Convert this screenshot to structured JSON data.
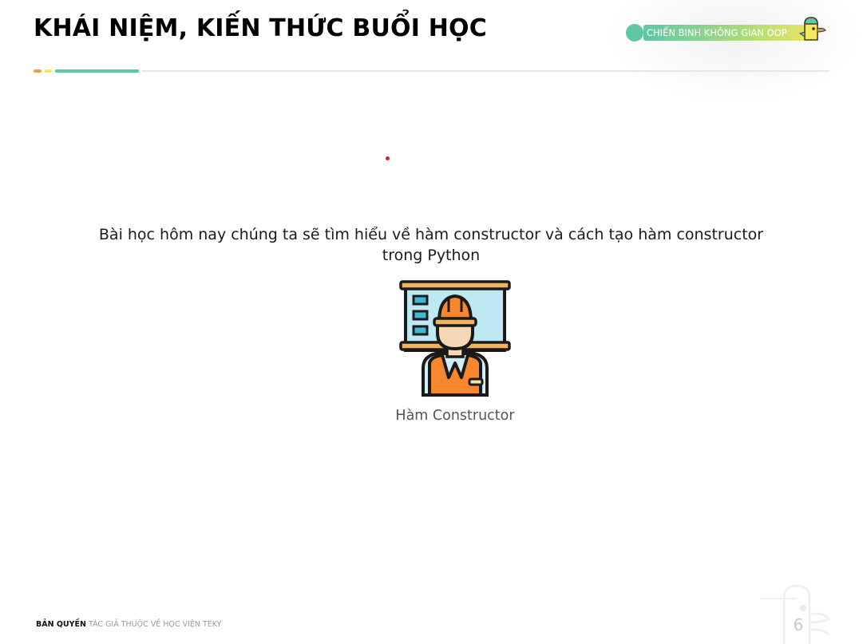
{
  "header": {
    "title": "KHÁI NIỆM, KIẾN THỨC BUỔI HỌC",
    "badge_label": "CHIẾN BINH KHÔNG GIAN OOP"
  },
  "main": {
    "intro_text": "Bài học hôm nay chúng ta sẽ tìm hiểu về hàm constructor và cách tạo hàm constructor trong Python",
    "illustration": "construction-worker-icon",
    "caption": "Hàm Constructor"
  },
  "footer": {
    "copyright_bold": "BẢN QUYỀN",
    "copyright_rest": "TÁC GIẢ THUỘC VỀ HỌC VIỆN TEKY",
    "page_number": "6"
  },
  "colors": {
    "accent_green": "#5fc6a6",
    "accent_yellow": "#f2e660",
    "accent_orange": "#f0a24a",
    "divider": "#e6e6e6"
  }
}
